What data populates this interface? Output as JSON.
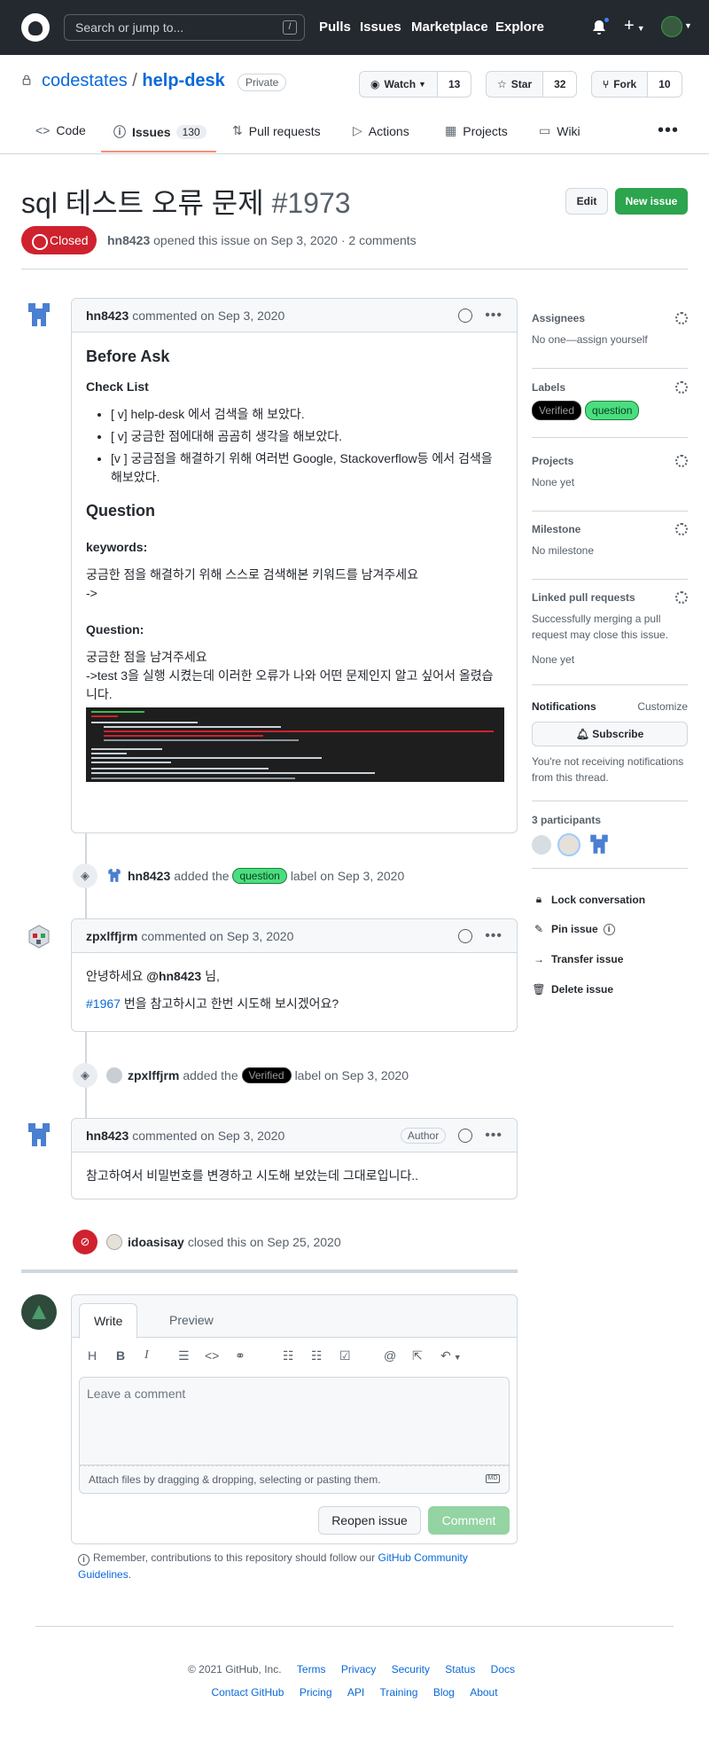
{
  "header": {
    "search_placeholder": "Search or jump to...",
    "slash_key": "/",
    "nav": [
      "Pulls",
      "Issues",
      "Marketplace",
      "Explore"
    ],
    "plus": "+"
  },
  "repo": {
    "owner": "codestates",
    "sep": "/",
    "name": "help-desk",
    "visibility": "Private",
    "watch_label": "Watch",
    "watch_count": "13",
    "star_label": "Star",
    "star_count": "32",
    "fork_label": "Fork",
    "fork_count": "10"
  },
  "tabs": [
    {
      "label": "Code",
      "icon": "code-icon"
    },
    {
      "label": "Issues",
      "icon": "issue-opened-icon",
      "count": "130"
    },
    {
      "label": "Pull requests",
      "icon": "git-pull-request-icon"
    },
    {
      "label": "Actions",
      "icon": "play-icon"
    },
    {
      "label": "Projects",
      "icon": "table-icon"
    },
    {
      "label": "Wiki",
      "icon": "book-icon"
    }
  ],
  "issue": {
    "title": "sql 테스트 오류 문제",
    "number": "#1973",
    "edit_label": "Edit",
    "new_label": "New issue",
    "state": "Closed",
    "author": "hn8423",
    "meta": "opened this issue on Sep 3, 2020 · 2 comments"
  },
  "comment1": {
    "author": "hn8423",
    "when": "commented on Sep 3, 2020",
    "h_before": "Before Ask",
    "h_check": "Check List",
    "checks": [
      "[ v] help-desk 에서 검색을 해 보았다.",
      "[ v] 궁금한 점에대해 곰곰히 생각을 해보았다.",
      "[v ] 궁금점을 해결하기 위해 여러번 Google, Stackoverflow등 에서 검색을 해보았다."
    ],
    "h_question": "Question",
    "h_keywords": "keywords:",
    "kw_text": "궁금한 점을 해결하기 위해 스스로 검색해본 키워드를 남겨주세요",
    "arrow": "->",
    "h_question2": "Question:",
    "q_text": "궁금한 점을 남겨주세요",
    "q_detail": "->test 3을 실행 시켰는데 이러한 오류가 나와 어떤 문제인지 알고 싶어서 올렸습니다."
  },
  "event1": {
    "actor": "hn8423",
    "pre": "added the",
    "label": "question",
    "post": "label on Sep 3, 2020"
  },
  "comment2": {
    "author": "zpxlffjrm",
    "when": "commented on Sep 3, 2020",
    "greet_pre": "안녕하세요",
    "mention": "@hn8423",
    "greet_post": "님,",
    "ref": "#1967",
    "ref_text": "번을 참고하시고 한번 시도해 보시겠어요?"
  },
  "event2": {
    "actor": "zpxlffjrm",
    "pre": "added the",
    "label": "Verified",
    "post": "label on Sep 3, 2020"
  },
  "comment3": {
    "author": "hn8423",
    "when": "commented on Sep 3, 2020",
    "badge": "Author",
    "text": "참고하여서 비밀번호를 변경하고 시도해 보았는데 그대로입니다.."
  },
  "event3": {
    "actor": "idoasisay",
    "text": "closed this on Sep 25, 2020"
  },
  "sidebar": {
    "assignees_h": "Assignees",
    "assignees_v": "No one—assign yourself",
    "labels_h": "Labels",
    "labels": [
      "Verified",
      "question"
    ],
    "projects_h": "Projects",
    "projects_v": "None yet",
    "milestone_h": "Milestone",
    "milestone_v": "No milestone",
    "linked_h": "Linked pull requests",
    "linked_desc": "Successfully merging a pull request may close this issue.",
    "linked_v": "None yet",
    "notif_h": "Notifications",
    "notif_customize": "Customize",
    "subscribe": "Subscribe",
    "notif_desc": "You're not receiving notifications from this thread.",
    "participants_h": "3 participants",
    "lock": "Lock conversation",
    "pin": "Pin issue",
    "transfer": "Transfer issue",
    "delete": "Delete issue"
  },
  "editor": {
    "tab_write": "Write",
    "tab_preview": "Preview",
    "placeholder": "Leave a comment",
    "attach": "Attach files by dragging & dropping, selecting or pasting them.",
    "md": "MD",
    "reopen": "Reopen issue",
    "comment": "Comment"
  },
  "remember": {
    "text": "Remember, contributions to this repository should follow our",
    "link": "GitHub Community Guidelines",
    "end": "."
  },
  "footer": {
    "copyright": "© 2021 GitHub, Inc.",
    "row1": [
      "Terms",
      "Privacy",
      "Security",
      "Status",
      "Docs"
    ],
    "row2": [
      "Contact GitHub",
      "Pricing",
      "API",
      "Training",
      "Blog",
      "About"
    ]
  }
}
